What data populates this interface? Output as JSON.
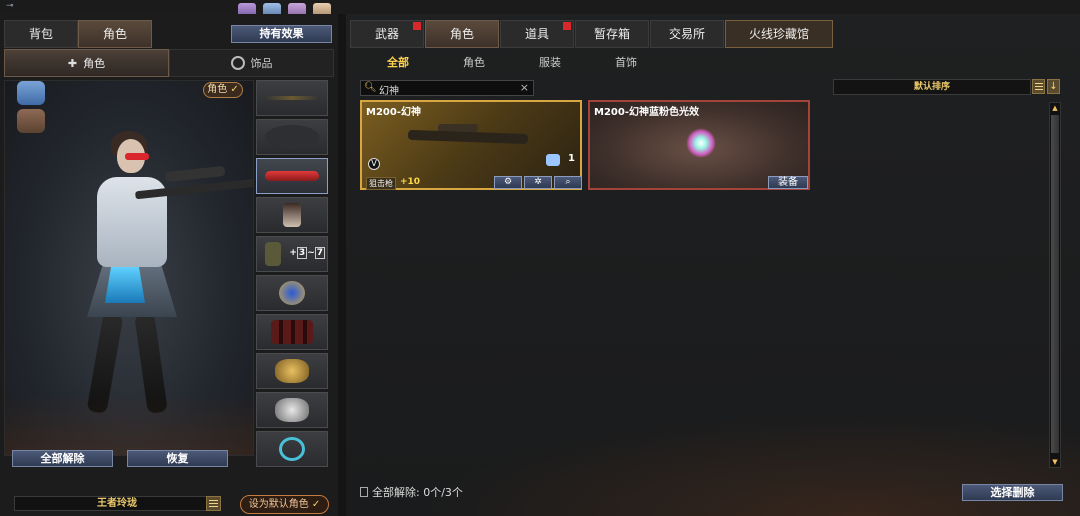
{
  "left": {
    "tabs": [
      {
        "label": "背包"
      },
      {
        "label": "角色"
      }
    ],
    "hold_effect_label": "持有效果",
    "subtabs": [
      {
        "label": "角色"
      },
      {
        "label": "饰品"
      }
    ],
    "role_badge": "角色",
    "unequip_all_label": "全部解除",
    "restore_label": "恢复",
    "slot_stat": {
      "plus": "+",
      "a": "3",
      "b": "7"
    },
    "character_name": "王者玲珑",
    "set_default_label": "设为默认角色"
  },
  "right": {
    "tabs": [
      {
        "label": "武器"
      },
      {
        "label": "角色"
      },
      {
        "label": "道具"
      },
      {
        "label": "暂存箱"
      },
      {
        "label": "交易所"
      },
      {
        "label": "火线珍藏馆"
      }
    ],
    "categories": [
      {
        "label": "全部"
      },
      {
        "label": "角色"
      },
      {
        "label": "服装"
      },
      {
        "label": "首饰"
      }
    ],
    "search": {
      "value": "幻神"
    },
    "sort_label": "默认排序",
    "items": [
      {
        "title": "M200-幻神",
        "count": "1",
        "tag": "狙击枪",
        "bonus": "+10"
      },
      {
        "title": "M200-幻神蓝粉色光效",
        "equip_label": "装备"
      }
    ],
    "bottom_status": "全部解除: 0个/3个",
    "select_delete_label": "选择删除"
  },
  "colors": {
    "accent_gold": "#ffd24c",
    "button_blue": "#2f3a52",
    "card1_border": "#d9a742",
    "card2_border": "#a4433a"
  }
}
